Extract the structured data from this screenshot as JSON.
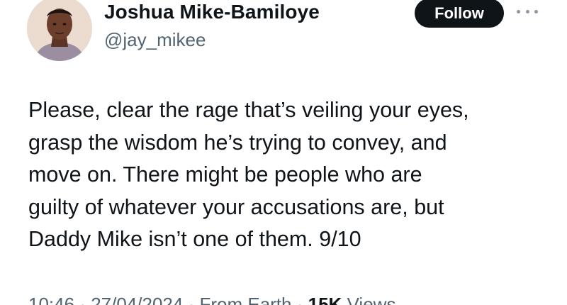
{
  "author": {
    "display_name": "Joshua Mike-Bamiloye",
    "handle": "@jay_mikee",
    "avatar_icon": "profile-photo"
  },
  "actions": {
    "follow_label": "Follow",
    "more_icon": "more-horizontal-icon"
  },
  "tweet": {
    "lines": [
      "Please, clear the rage that’s veiling your eyes,",
      "grasp the wisdom he’s trying to convey, and",
      "move on. There might be people who are",
      "guilty of whatever your accusations are, but",
      "Daddy Mike isn’t one of them. 9/10"
    ]
  },
  "meta": {
    "time": "10:46",
    "date": "27/04/2024",
    "source": "From Earth",
    "views_count": "15K",
    "views_label": "Views"
  },
  "colors": {
    "text": "#0f1419",
    "secondary_text": "#536471",
    "follow_button_bg": "#0f1419",
    "follow_button_text": "#ffffff"
  }
}
